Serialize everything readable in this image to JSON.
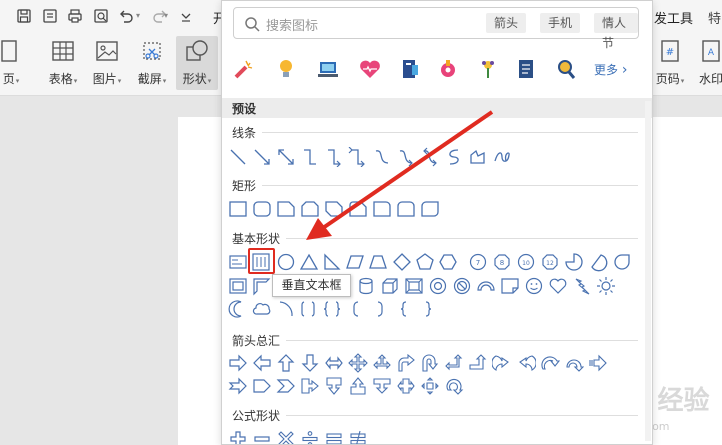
{
  "topbar": {
    "cut_text_left": "开",
    "cut_text_right": "发工具",
    "cut_text_far": "特"
  },
  "ribbon": {
    "items": [
      {
        "label": "页",
        "has_arrow": true
      },
      {
        "label": "表格",
        "has_arrow": true
      },
      {
        "label": "图片",
        "has_arrow": true
      },
      {
        "label": "截屏",
        "has_arrow": true
      },
      {
        "label": "形状",
        "has_arrow": true
      },
      {
        "label": "页码",
        "has_arrow": true
      },
      {
        "label": "水印",
        "has_arrow": false
      }
    ],
    "arrow_glyph": "▾"
  },
  "popup": {
    "search_placeholder": "搜索图标",
    "tags": [
      "箭头",
      "手机",
      "情人节"
    ],
    "more_label": "更多",
    "more_glyph": "›",
    "preset_label": "预设",
    "sections": [
      "线条",
      "矩形",
      "基本形状",
      "箭头总汇",
      "公式形状"
    ],
    "tooltip": "垂直文本框"
  },
  "watermark": {
    "brand": "Bai du 经验",
    "url": "jingyan.baidu.com"
  },
  "colors": {
    "shape_stroke": "#4a72b0",
    "highlight": "#e02b20",
    "arrow": "#e02b20",
    "link": "#3b6fb6"
  },
  "icons": {
    "recommended": [
      "firework-icon",
      "lightbulb-icon",
      "laptop-icon",
      "heart-pulse-icon",
      "book-icon",
      "mailbox-icon",
      "flower-icon",
      "document-icon",
      "magnifier-icon"
    ]
  }
}
